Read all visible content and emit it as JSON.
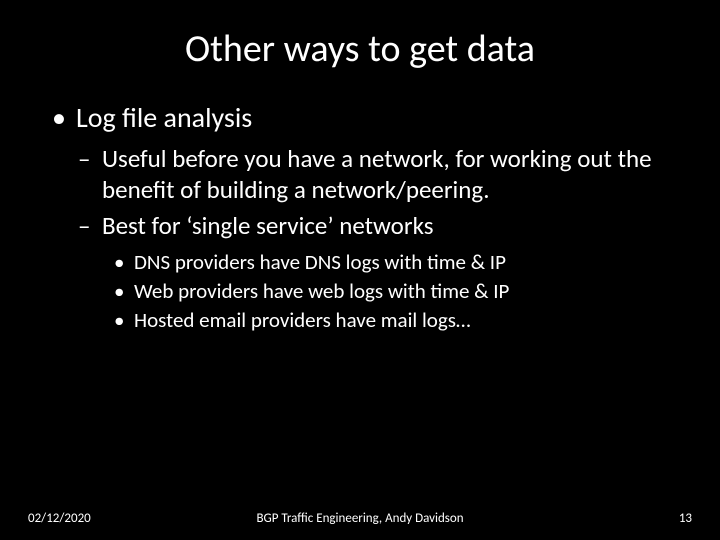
{
  "title": "Other ways to get data",
  "bullets": {
    "l1_0": "Log file analysis",
    "l2_0": "Useful before you have a network, for working out the benefit of building a network/peering.",
    "l2_1": "Best for ‘single service’ networks",
    "l3_0": "DNS providers have DNS logs with time & IP",
    "l3_1": "Web providers have web logs with time & IP",
    "l3_2": "Hosted email providers have mail logs…"
  },
  "footer": {
    "date": "02/12/2020",
    "center": "BGP Traffic Engineering, Andy Davidson",
    "page": "13"
  }
}
